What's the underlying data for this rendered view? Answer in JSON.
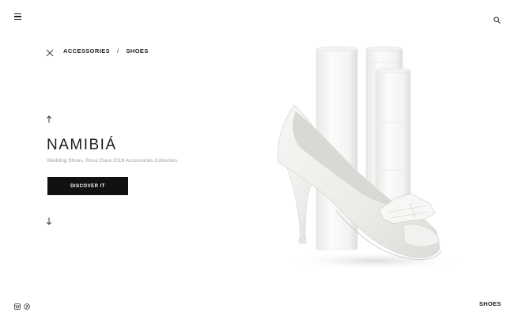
{
  "header": {
    "menu_icon": "hamburger-menu-icon",
    "search_icon": "search-icon"
  },
  "breadcrumb": {
    "close_icon": "close-icon",
    "items": [
      "ACCESSORIES",
      "SHOES"
    ],
    "separator": "/"
  },
  "product": {
    "title": "NAMIBIÁ",
    "subtitle": "Wedding Shoes. Rosa Clará 2016 Accessories Collection.",
    "cta_label": "DISCOVER IT",
    "prev_icon": "arrow-up-icon",
    "next_icon": "arrow-down-icon",
    "image_icon": "white-peep-toe-heel-with-bow"
  },
  "footer": {
    "social_icons": [
      "instagram-icon",
      "pinterest-icon"
    ],
    "section_label": "SHOES"
  },
  "colors": {
    "background": "#ffffff",
    "button": "#111111",
    "text": "#1a1a1a",
    "subtitle": "#9e9e9e"
  }
}
